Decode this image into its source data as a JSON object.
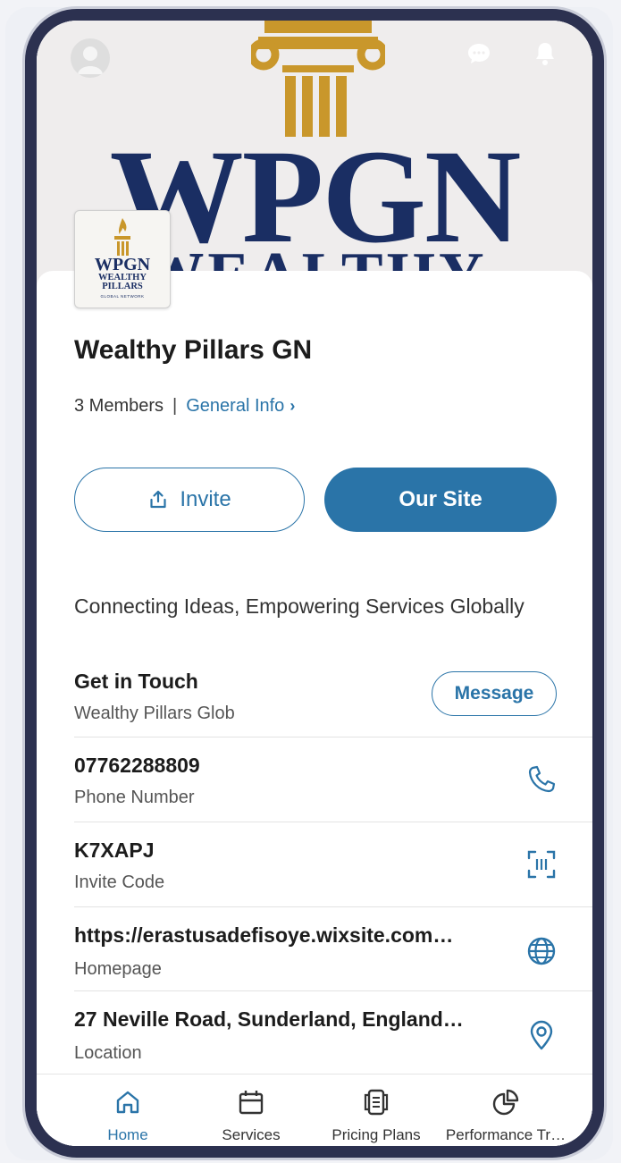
{
  "colors": {
    "accent": "#2a74a8",
    "brand_navy": "#1a2e63",
    "brand_gold": "#c9972b"
  },
  "cover": {
    "wordmark": "WPGN",
    "wordmark_sub": "WEALTHY"
  },
  "logo": {
    "line1": "WPGN",
    "line2": "WEALTHY",
    "line3": "PILLARS",
    "line4": "GLOBAL NETWORK"
  },
  "group": {
    "name": "Wealthy Pillars GN",
    "members": "3 Members",
    "separator": "|",
    "general_info": "General Info",
    "chevron": "›"
  },
  "actions": {
    "invite": "Invite",
    "our_site": "Our Site"
  },
  "tagline": "Connecting Ideas, Empowering Services Globally",
  "contact": {
    "title": "Get in Touch",
    "subtitle": "Wealthy Pillars Glob",
    "message_button": "Message"
  },
  "details": [
    {
      "value": "07762288809",
      "label": "Phone Number",
      "icon": "phone-icon"
    },
    {
      "value": "K7XAPJ",
      "label": "Invite Code",
      "icon": "qr-scan-icon"
    },
    {
      "value": "https://erastusadefisoye.wixsite.com…",
      "label": "Homepage",
      "icon": "globe-icon"
    },
    {
      "value": "27 Neville Road, Sunderland, England…",
      "label": "Location",
      "icon": "location-pin-icon"
    }
  ],
  "nav": [
    {
      "label": "Home",
      "icon": "home-icon",
      "active": true
    },
    {
      "label": "Services",
      "icon": "calendar-icon",
      "active": false
    },
    {
      "label": "Pricing Plans",
      "icon": "pricing-icon",
      "active": false
    },
    {
      "label": "Performance Tr…",
      "icon": "pie-chart-icon",
      "active": false
    }
  ]
}
